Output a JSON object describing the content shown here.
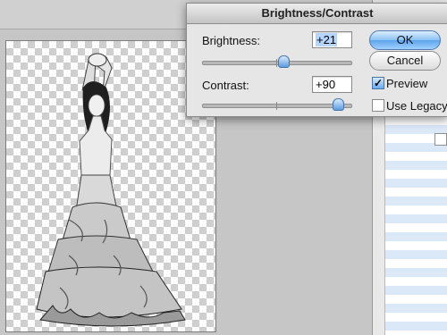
{
  "dialog": {
    "title": "Brightness/Contrast",
    "brightness_label": "Brightness:",
    "brightness_value": "+21",
    "brightness_level": 0.55,
    "contrast_label": "Contrast:",
    "contrast_value": "+90",
    "contrast_level": 0.95,
    "ok_label": "OK",
    "cancel_label": "Cancel",
    "preview_label": "Preview",
    "preview_checked": true,
    "legacy_label": "Use Legacy",
    "legacy_checked": false
  },
  "colors": {
    "default_button": "#6aa8ee",
    "slider_thumb": "#5d9be0",
    "canvas_checker": "#cfcfcf"
  }
}
